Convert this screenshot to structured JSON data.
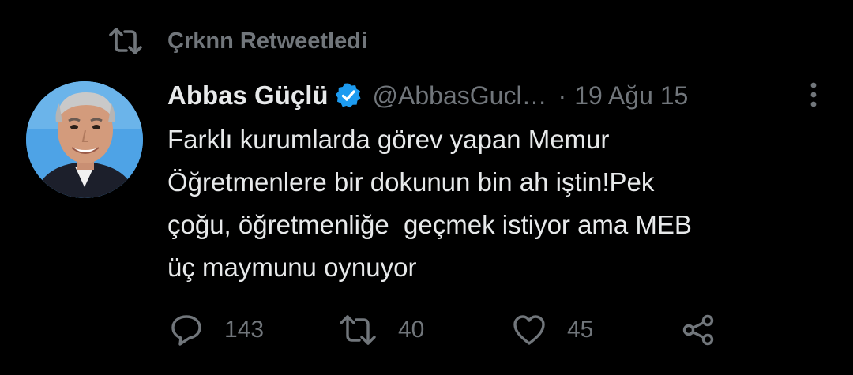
{
  "retweet_banner": {
    "text": "Çrknn Retweetledi",
    "icon": "retweet-icon"
  },
  "author": {
    "display_name": "Abbas Güçlü",
    "handle": "@AbbasGucl…",
    "verified": true,
    "verified_color": "#1d9bf0",
    "separator": "·",
    "timestamp": "19 Ağu 15"
  },
  "tweet": {
    "text": "Farklı kurumlarda görev yapan Memur\nÖğretmenlere bir dokunun bin ah iştin!Pek\nçoğu, öğretmenliğe  geçmek istiyor ama MEB\nüç maymunu oynuyor"
  },
  "actions": {
    "reply": {
      "icon": "reply-icon",
      "count": "143"
    },
    "retweet": {
      "icon": "retweet-icon",
      "count": "40"
    },
    "like": {
      "icon": "heart-icon",
      "count": "45"
    },
    "share": {
      "icon": "share-icon"
    }
  },
  "colors": {
    "background": "#000000",
    "primary_text": "#e7e9ea",
    "secondary_text": "#71767b",
    "accent": "#1d9bf0"
  }
}
